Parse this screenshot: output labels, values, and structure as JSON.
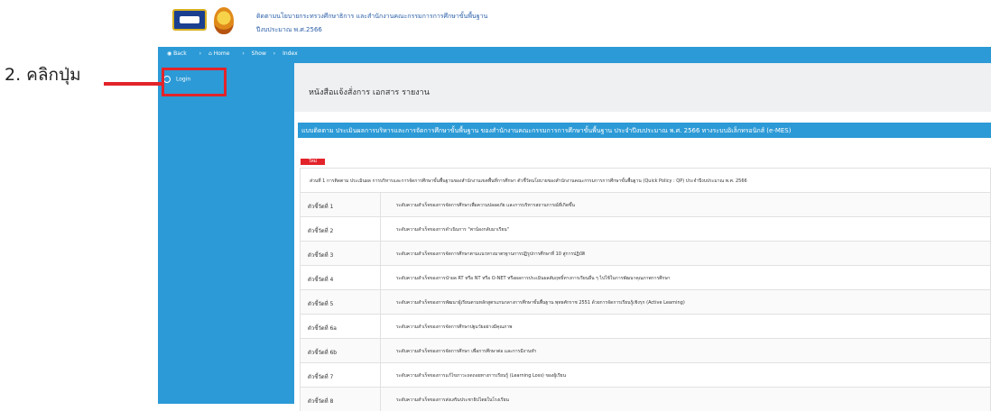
{
  "header": {
    "title": "ติดตามนโยบายกระทรวงศึกษาธิการ และสำนักงานคณะกรรมการการศึกษาขั้นพื้นฐาน",
    "subtitle": "ปีงบประมาณ พ.ศ.2566"
  },
  "breadcrumb": {
    "back": "Back",
    "sep1": "›",
    "home": "Home",
    "sep2": "›",
    "show": "Show",
    "sep3": "›",
    "index": "Index"
  },
  "sidebar": {
    "login_label": "Login"
  },
  "annotation": {
    "label": "2. คลิกปุ่ม"
  },
  "page": {
    "title": "หนังสือแจ้งสั่งการ เอกสาร รายงาน",
    "banner": "แบบติดตาม ประเมินผลการบริหารและการจัดการศึกษาขั้นพื้นฐาน ของสำนักงานคณะกรรมการการศึกษาขั้นพื้นฐาน ประจำปีงบประมาณ พ.ศ. 2566 ทางระบบอิเล็กทรอนิกส์ (e-MES)",
    "new_badge": "ใหม่",
    "intro": "ส่วนที่ 1 การติดตาม ประเมินผล การบริหารและการจัดการศึกษาขั้นพื้นฐานของสำนักงานเขตพื้นที่การศึกษา ตัวชี้วัดนโยบายของสำนักงานคณะกรรมการการศึกษาขั้นพื้นฐาน (Quick Policy : QP) ประจำปีงบประมาณ พ.ศ. 2566"
  },
  "rows": [
    {
      "id": "ตัวชี้วัดที่ 1",
      "text": "ระดับความสำเร็จของการจัดการศึกษาเพื่อความปลอดภัย และการบริหารสถานการณ์ที่เกิดขึ้น"
    },
    {
      "id": "ตัวชี้วัดที่ 2",
      "text": "ระดับความสำเร็จของการดำเนินการ \"พาน้องกลับมาเรียน\""
    },
    {
      "id": "ตัวชี้วัดที่ 3",
      "text": "ระดับความสำเร็จของการจัดการศึกษาตามแนวทางมาตรฐานการปฏิรูปการศึกษาที่ 10 สู่การปฏิบัติ"
    },
    {
      "id": "ตัวชี้วัดที่ 4",
      "text": "ระดับความสำเร็จของการนำผล RT หรือ NT หรือ O-NET หรือผลการประเมินผลสัมฤทธิ์ทางการเรียนอื่น ๆ ไปใช้ในการพัฒนาคุณภาพการศึกษา"
    },
    {
      "id": "ตัวชี้วัดที่ 5",
      "text": "ระดับความสำเร็จของการพัฒนาผู้เรียนตามหลักสูตรแกนกลางการศึกษาขั้นพื้นฐาน พุทธศักราช 2551 ด้วยการจัดการเรียนรู้เชิงรุก (Active Learning)"
    },
    {
      "id": "ตัวชี้วัดที่ 6a",
      "text": "ระดับความสำเร็จของการจัดการศึกษาปฐมวัยอย่างมีคุณภาพ"
    },
    {
      "id": "ตัวชี้วัดที่ 6b",
      "text": "ระดับความสำเร็จของการจัดการศึกษา เพื่อการศึกษาต่อ และการมีงานทำ"
    },
    {
      "id": "ตัวชี้วัดที่ 7",
      "text": "ระดับความสำเร็จของการแก้ไขภาวะถดถอยทางการเรียนรู้ (Learning Loss) ของผู้เรียน"
    },
    {
      "id": "ตัวชี้วัดที่ 8",
      "text": "ระดับความสำเร็จของการส่งเสริมประชาธิปไตยในโรงเรียน"
    }
  ]
}
